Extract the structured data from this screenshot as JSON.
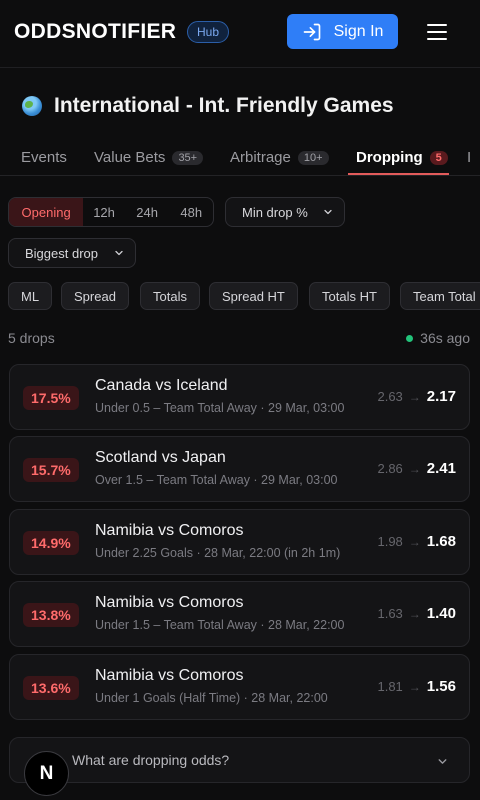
{
  "header": {
    "logo": "ODDSNOTIFIER",
    "badge": "Hub",
    "signin_label": "Sign In"
  },
  "page": {
    "title": "International - Int. Friendly Games"
  },
  "tabs": [
    {
      "label": "Events",
      "count": ""
    },
    {
      "label": "Value Bets",
      "count": "35+"
    },
    {
      "label": "Arbitrage",
      "count": "10+"
    },
    {
      "label": "Dropping",
      "count": "5"
    },
    {
      "label": "I",
      "count": ""
    }
  ],
  "filters": {
    "periods": [
      "Opening",
      "12h",
      "24h",
      "48h"
    ],
    "selected_period": "Opening",
    "min_drop_label": "Min drop %",
    "sort_label": "Biggest drop",
    "markets": [
      "ML",
      "Spread",
      "Totals",
      "Spread HT",
      "Totals HT",
      "Team Total"
    ]
  },
  "summary": {
    "count_text": "5 drops",
    "updated_text": "36s ago"
  },
  "drops": [
    {
      "pct": "17.5%",
      "match": "Canada vs Iceland",
      "detail": "Under 0.5 – Team Total Away · 29 Mar, 03:00",
      "old_odd": "2.63",
      "new_odd": "2.17"
    },
    {
      "pct": "15.7%",
      "match": "Scotland vs Japan",
      "detail": "Over 1.5 – Team Total Away · 29 Mar, 03:00",
      "old_odd": "2.86",
      "new_odd": "2.41"
    },
    {
      "pct": "14.9%",
      "match": "Namibia vs Comoros",
      "detail": "Under 2.25 Goals · 28 Mar, 22:00 (in 2h 1m)",
      "old_odd": "1.98",
      "new_odd": "1.68"
    },
    {
      "pct": "13.8%",
      "match": "Namibia vs Comoros",
      "detail": "Under 1.5 – Team Total Away · 28 Mar, 22:00",
      "old_odd": "1.63",
      "new_odd": "1.40"
    },
    {
      "pct": "13.6%",
      "match": "Namibia vs Comoros",
      "detail": "Under 1 Goals (Half Time) · 28 Mar, 22:00",
      "old_odd": "1.81",
      "new_odd": "1.56"
    }
  ],
  "faq": {
    "question": "What are dropping odds?"
  },
  "float_button": {
    "letter": "N"
  },
  "colors": {
    "accent": "#2f7ef7",
    "drop_red": "#ff6b6b",
    "live_green": "#22c37a"
  }
}
